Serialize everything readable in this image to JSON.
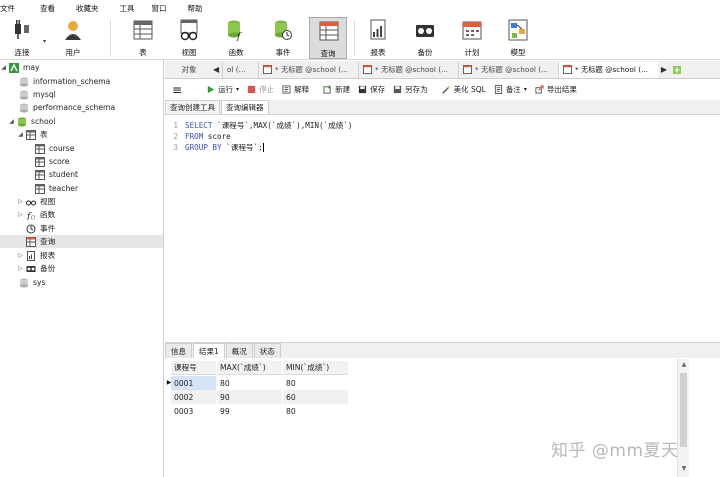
{
  "menu": [
    "文件",
    "查看",
    "收藏夹",
    "工具",
    "窗口",
    "帮助"
  ],
  "toolbar": {
    "connect": "连接",
    "user": "用户",
    "table": "表",
    "view": "视图",
    "function": "函数",
    "event": "事件",
    "query": "查询",
    "report": "报表",
    "backup": "备份",
    "schedule": "计划",
    "model": "模型"
  },
  "navigator": {
    "connection": "may",
    "databases": [
      "information_schema",
      "mysql",
      "performance_schema"
    ],
    "school": "school",
    "tables_label": "表",
    "tables": [
      "course",
      "score",
      "student",
      "teacher"
    ],
    "views": "视图",
    "functions": "函数",
    "events": "事件",
    "queries": "查询",
    "reports": "报表",
    "backups": "备份",
    "sys": "sys"
  },
  "tabs": {
    "objects": "对象",
    "partial": "ol (...",
    "query_tab": "* 无标题 @school (...",
    "active_tab": "* 无标题 @school (..."
  },
  "query_toolbar": {
    "run": "运行",
    "stop": "停止",
    "explain": "解释",
    "new": "新建",
    "save": "保存",
    "save_as": "另存为",
    "beautify": "美化 SQL",
    "comment": "备注",
    "export": "导出结果"
  },
  "subtabs": [
    "查询创建工具",
    "查询编辑器"
  ],
  "editor": {
    "lines": [
      {
        "num": "1",
        "kw": "SELECT",
        "rest": " `课程号`,MAX(`成绩`),MIN(`成绩`)"
      },
      {
        "num": "2",
        "kw": "FROM",
        "rest": " score"
      },
      {
        "num": "3",
        "kw": "GROUP BY",
        "rest": " `课程号`;"
      }
    ]
  },
  "result_tabs": [
    "信息",
    "结果1",
    "概况",
    "状态"
  ],
  "result": {
    "columns": [
      "课程号",
      "MAX(`成绩`)",
      "MIN(`成绩`)"
    ],
    "rows": [
      [
        "0001",
        "80",
        "80"
      ],
      [
        "0002",
        "90",
        "60"
      ],
      [
        "0003",
        "99",
        "80"
      ]
    ]
  },
  "watermark": "知乎 @mm夏天",
  "colors": {
    "keyword": "#3a52c4",
    "run_green": "#2e9a3a",
    "stop_red": "#d9534f",
    "selection": "#d7e4f7"
  }
}
